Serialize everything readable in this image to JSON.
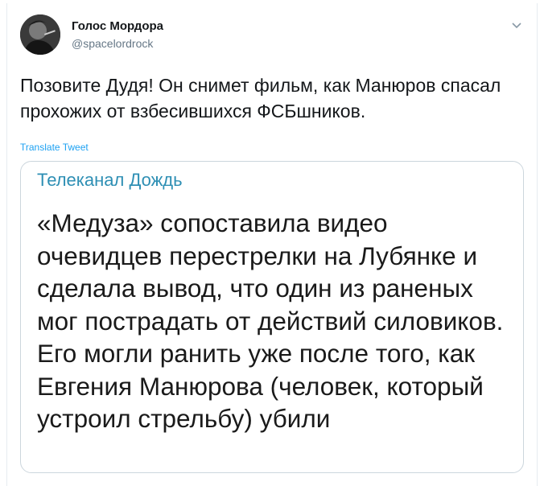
{
  "author": {
    "display_name": "Голос Мордора",
    "handle": "@spacelordrock",
    "avatar_icon": "avatar-photo"
  },
  "tweet": {
    "text": "Позовите Дудя! Он снимет фильм, как Манюров спасал прохожих от взбесившихся ФСБшников.",
    "translate_label": "Translate Tweet",
    "menu_icon": "chevron-down-icon"
  },
  "quoted_image": {
    "source": "Телеканал Дождь",
    "text": "«Медуза» сопоставила видео очевидцев перестрелки на Лубянке и сделала вывод, что один из раненых мог пострадать от действий силовиков. Его могли ранить уже после того, как Евгения Манюрова (человек, который устроил стрельбу) убили"
  },
  "colors": {
    "link": "#1da1f2",
    "source": "#2e8fb4",
    "secondary_text": "#657786",
    "border": "#ccd6dd"
  }
}
